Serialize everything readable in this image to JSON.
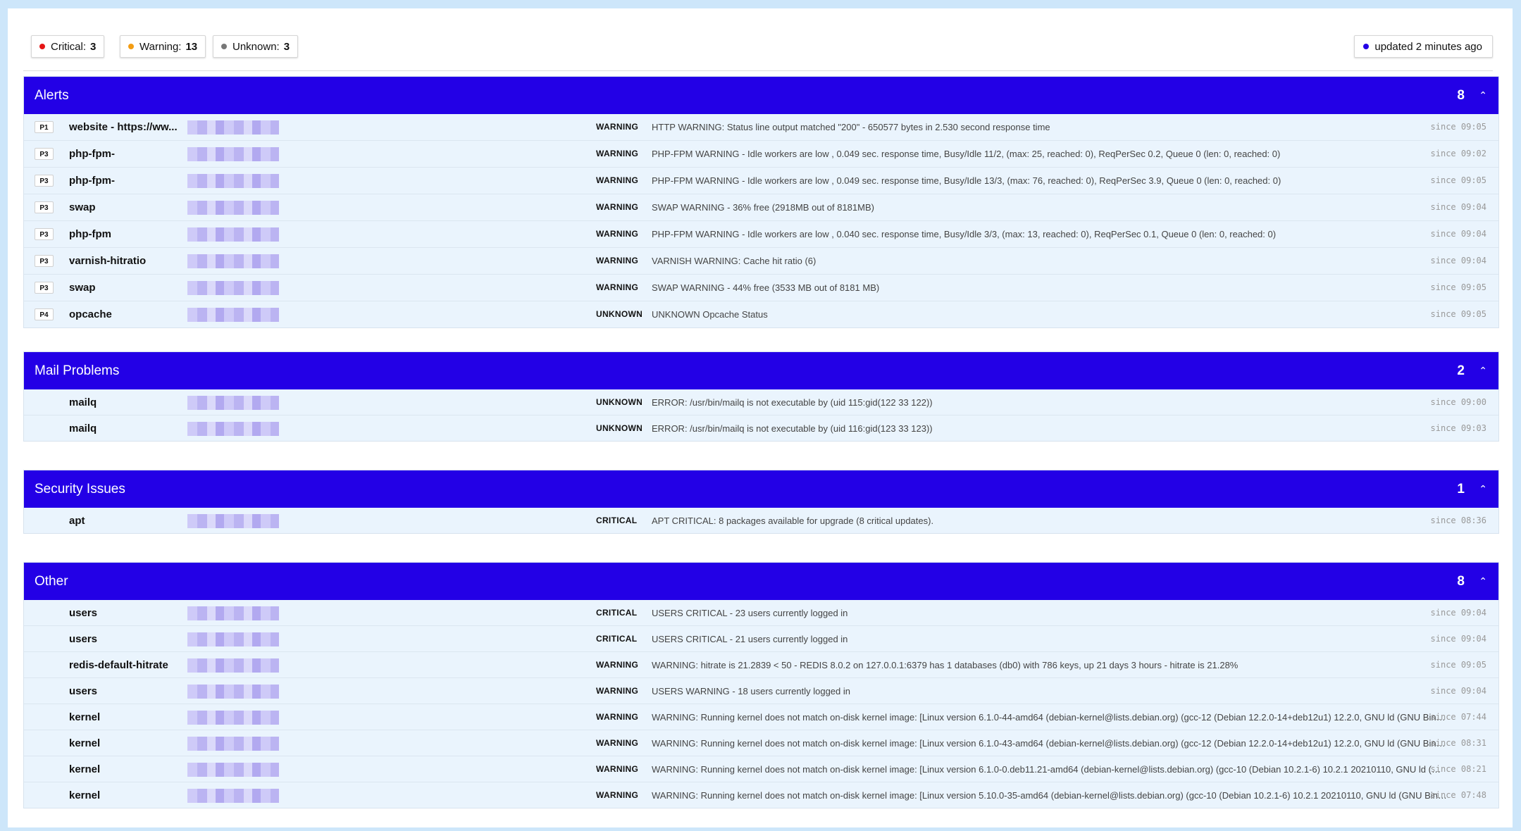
{
  "summary": {
    "critical": {
      "label": "Critical:",
      "count": "3",
      "color": "#e51515"
    },
    "warning": {
      "label": "Warning:",
      "count": "13",
      "color": "#f39c12"
    },
    "unknown": {
      "label": "Unknown:",
      "count": "3",
      "color": "#777777"
    },
    "updated": {
      "label": "updated 2 minutes ago",
      "color": "#2300e6"
    }
  },
  "sections": [
    {
      "title": "Alerts",
      "count": "8",
      "chevron": "⌃",
      "rows": [
        {
          "prio": "P1",
          "service": "website - https://ww...",
          "state": "WARNING",
          "output": "HTTP WARNING: Status line output matched \"200\" - 650577 bytes in 2.530 second response time",
          "since": "since 09:05"
        },
        {
          "prio": "P3",
          "service": "php-fpm-",
          "state": "WARNING",
          "output": "PHP-FPM WARNING - Idle workers are low , 0.049 sec. response time, Busy/Idle 11/2, (max: 25, reached: 0), ReqPerSec 0.2, Queue 0 (len: 0, reached: 0)",
          "since": "since 09:02"
        },
        {
          "prio": "P3",
          "service": "php-fpm-",
          "state": "WARNING",
          "output": "PHP-FPM WARNING - Idle workers are low , 0.049 sec. response time, Busy/Idle 13/3, (max: 76, reached: 0), ReqPerSec 3.9, Queue 0 (len: 0, reached: 0)",
          "since": "since 09:05"
        },
        {
          "prio": "P3",
          "service": "swap",
          "state": "WARNING",
          "output": "SWAP WARNING - 36% free (2918MB out of 8181MB)",
          "since": "since 09:04"
        },
        {
          "prio": "P3",
          "service": "php-fpm",
          "state": "WARNING",
          "output": "PHP-FPM WARNING - Idle workers are low , 0.040 sec. response time, Busy/Idle 3/3, (max: 13, reached: 0), ReqPerSec 0.1, Queue 0 (len: 0, reached: 0)",
          "since": "since 09:04"
        },
        {
          "prio": "P3",
          "service": "varnish-hitratio",
          "state": "WARNING",
          "output": "VARNISH WARNING: Cache hit ratio (6)",
          "since": "since 09:04"
        },
        {
          "prio": "P3",
          "service": "swap",
          "state": "WARNING",
          "output": "SWAP WARNING - 44% free (3533 MB out of 8181 MB)",
          "since": "since 09:05"
        },
        {
          "prio": "P4",
          "service": "opcache",
          "state": "UNKNOWN",
          "output": "UNKNOWN Opcache Status",
          "since": "since 09:05"
        }
      ]
    },
    {
      "title": "Mail Problems",
      "count": "2",
      "chevron": "⌃",
      "rows": [
        {
          "prio": "",
          "service": "mailq",
          "state": "UNKNOWN",
          "output": "ERROR: /usr/bin/mailq is not executable by (uid 115:gid(122 33 122))",
          "since": "since 09:00"
        },
        {
          "prio": "",
          "service": "mailq",
          "state": "UNKNOWN",
          "output": "ERROR: /usr/bin/mailq is not executable by (uid 116:gid(123 33 123))",
          "since": "since 09:03"
        }
      ]
    },
    {
      "title": "Security Issues",
      "count": "1",
      "chevron": "⌃",
      "rows": [
        {
          "prio": "",
          "service": "apt",
          "state": "CRITICAL",
          "output": "APT CRITICAL: 8 packages available for upgrade (8 critical updates).",
          "since": "since 08:36"
        }
      ]
    },
    {
      "title": "Other",
      "count": "8",
      "chevron": "⌃",
      "rows": [
        {
          "prio": "",
          "service": "users",
          "state": "CRITICAL",
          "output": "USERS CRITICAL - 23 users currently logged in",
          "since": "since 09:04"
        },
        {
          "prio": "",
          "service": "users",
          "state": "CRITICAL",
          "output": "USERS CRITICAL - 21 users currently logged in",
          "since": "since 09:04"
        },
        {
          "prio": "",
          "service": "redis-default-hitrate",
          "state": "WARNING",
          "output": "WARNING: hitrate is 21.2839 < 50 - REDIS 8.0.2 on 127.0.0.1:6379 has 1 databases (db0) with 786 keys, up 21 days 3 hours - hitrate is 21.28%",
          "since": "since 09:05"
        },
        {
          "prio": "",
          "service": "users",
          "state": "WARNING",
          "output": "USERS WARNING - 18 users currently logged in",
          "since": "since 09:04"
        },
        {
          "prio": "",
          "service": "kernel",
          "state": "WARNING",
          "output": "WARNING: Running kernel does not match on-disk kernel image: [Linux version 6.1.0-44-amd64 (debian-kernel@lists.debian.org) (gcc-12 (Debian 12.2.0-14+deb12u1) 12.2.0, GNU ld (GNU Binuti...",
          "since": "since 07:44"
        },
        {
          "prio": "",
          "service": "kernel",
          "state": "WARNING",
          "output": "WARNING: Running kernel does not match on-disk kernel image: [Linux version 6.1.0-43-amd64 (debian-kernel@lists.debian.org) (gcc-12 (Debian 12.2.0-14+deb12u1) 12.2.0, GNU ld (GNU Binuti...",
          "since": "since 08:31"
        },
        {
          "prio": "",
          "service": "kernel",
          "state": "WARNING",
          "output": "WARNING: Running kernel does not match on-disk kernel image: [Linux version 6.1.0-0.deb11.21-amd64 (debian-kernel@lists.debian.org) (gcc-10 (Debian 10.2.1-6) 10.2.1 20210110, GNU ld (GNU ...",
          "since": "since 08:21"
        },
        {
          "prio": "",
          "service": "kernel",
          "state": "WARNING",
          "output": "WARNING: Running kernel does not match on-disk kernel image: [Linux version 5.10.0-35-amd64 (debian-kernel@lists.debian.org) (gcc-10 (Debian 10.2.1-6) 10.2.1 20210110, GNU ld (GNU Binutil...",
          "since": "since 07:48"
        }
      ]
    }
  ]
}
